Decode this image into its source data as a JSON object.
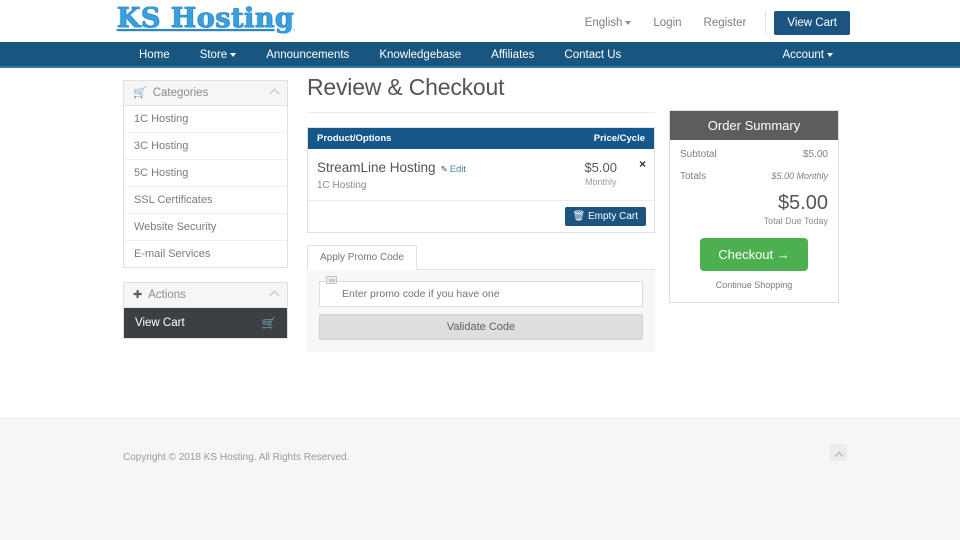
{
  "header": {
    "logo_text": "KS Hosting",
    "language": "English",
    "login": "Login",
    "register": "Register",
    "view_cart_button": "View Cart"
  },
  "nav": {
    "items": [
      {
        "label": "Home",
        "caret": false
      },
      {
        "label": "Store",
        "caret": true
      },
      {
        "label": "Announcements",
        "caret": false
      },
      {
        "label": "Knowledgebase",
        "caret": false
      },
      {
        "label": "Affiliates",
        "caret": false
      },
      {
        "label": "Contact Us",
        "caret": false
      }
    ],
    "account": "Account"
  },
  "sidebar": {
    "categories_title": "Categories",
    "categories": [
      "1C Hosting",
      "3C Hosting",
      "5C Hosting",
      "SSL Certificates",
      "Website Security",
      "E-mail Services"
    ],
    "actions_title": "Actions",
    "actions": [
      {
        "label": "View Cart"
      }
    ]
  },
  "main": {
    "page_title": "Review & Checkout",
    "table": {
      "col_product": "Product/Options",
      "col_price": "Price/Cycle",
      "rows": [
        {
          "name": "StreamLine Hosting",
          "edit": "Edit",
          "sub": "1C Hosting",
          "price": "$5.00",
          "cycle": "Monthly",
          "remove": "×"
        }
      ],
      "empty_cart_button": "Empty Cart"
    },
    "promo": {
      "tab_label": "Apply Promo Code",
      "placeholder": "Enter promo code if you have one",
      "value": "",
      "validate_button": "Validate Code"
    }
  },
  "summary": {
    "title": "Order Summary",
    "rows": [
      {
        "label": "Subtotal",
        "value": "$5.00"
      },
      {
        "label": "Totals",
        "value": "$5.00 Monthly"
      }
    ],
    "total_amount": "$5.00",
    "total_label": "Total Due Today",
    "checkout_button": "Checkout",
    "checkout_arrow": "→",
    "continue_link": "Continue Shopping"
  },
  "footer": {
    "copyright": "Copyright © 2018 KS Hosting. All Rights Reserved."
  },
  "colors": {
    "nav_blue": "#18567f",
    "table_header_blue": "#15578a",
    "button_blue": "#1b5480",
    "checkout_green": "#4cb050",
    "summary_gray": "#5d5d5d",
    "action_dark": "#3c4043"
  }
}
